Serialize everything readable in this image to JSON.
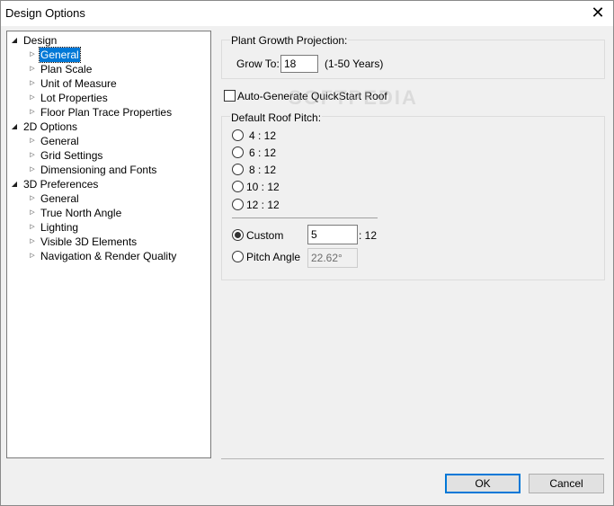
{
  "window": {
    "title": "Design Options",
    "close_label": "✕"
  },
  "tree": [
    {
      "label": "Design",
      "level": 0,
      "expanded": true,
      "selected": false
    },
    {
      "label": "General",
      "level": 1,
      "expanded": false,
      "selected": true
    },
    {
      "label": "Plan Scale",
      "level": 1,
      "expanded": false,
      "selected": false
    },
    {
      "label": "Unit of Measure",
      "level": 1,
      "expanded": false,
      "selected": false
    },
    {
      "label": "Lot Properties",
      "level": 1,
      "expanded": false,
      "selected": false
    },
    {
      "label": "Floor Plan Trace Properties",
      "level": 1,
      "expanded": false,
      "selected": false
    },
    {
      "label": "2D Options",
      "level": 0,
      "expanded": true,
      "selected": false
    },
    {
      "label": "General",
      "level": 1,
      "expanded": false,
      "selected": false
    },
    {
      "label": "Grid Settings",
      "level": 1,
      "expanded": false,
      "selected": false
    },
    {
      "label": "Dimensioning and Fonts",
      "level": 1,
      "expanded": false,
      "selected": false
    },
    {
      "label": "3D Preferences",
      "level": 0,
      "expanded": true,
      "selected": false
    },
    {
      "label": "General",
      "level": 1,
      "expanded": false,
      "selected": false
    },
    {
      "label": "True North Angle",
      "level": 1,
      "expanded": false,
      "selected": false
    },
    {
      "label": "Lighting",
      "level": 1,
      "expanded": false,
      "selected": false
    },
    {
      "label": "Visible 3D Elements",
      "level": 1,
      "expanded": false,
      "selected": false
    },
    {
      "label": "Navigation & Render Quality",
      "level": 1,
      "expanded": false,
      "selected": false
    }
  ],
  "growth": {
    "title": "Plant Growth Projection:",
    "grow_to_label": "Grow To:",
    "grow_to_value": "18",
    "range_hint": "(1-50 Years)"
  },
  "quickstart": {
    "label": "Auto-Generate QuickStart Roof",
    "checked": false
  },
  "watermark": "SOFTPEDIA",
  "roof": {
    "title": "Default Roof Pitch:",
    "options": [
      {
        "label": "4 : 12",
        "checked": false
      },
      {
        "label": "6 : 12",
        "checked": false
      },
      {
        "label": "8 : 12",
        "checked": false
      },
      {
        "label": "10 : 12",
        "checked": false
      },
      {
        "label": "12 : 12",
        "checked": false
      }
    ],
    "custom": {
      "label": "Custom",
      "checked": true,
      "value": "5",
      "suffix": ": 12"
    },
    "pitch_angle": {
      "label": "Pitch Angle",
      "checked": false,
      "value": "22.62°"
    }
  },
  "buttons": {
    "ok": "OK",
    "cancel": "Cancel"
  },
  "colors": {
    "selection": "#0078d7",
    "default_button_border": "#0078d7"
  }
}
